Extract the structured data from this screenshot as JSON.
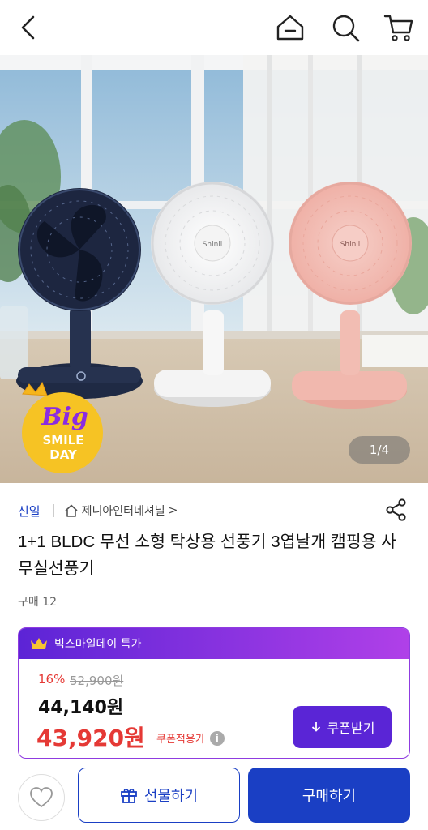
{
  "header": {
    "back_icon": "chevron-left-icon",
    "home_icon": "home-icon",
    "search_icon": "search-icon",
    "cart_icon": "cart-icon"
  },
  "gallery": {
    "page_indicator": "1/4",
    "badge": {
      "line1": "Big",
      "line2": "SMILE",
      "line3": "DAY"
    }
  },
  "seller": {
    "brand": "신일",
    "shop_name": "제니아인터네셔널",
    "shop_chevron": ">"
  },
  "product": {
    "title": "1+1 BLDC 무선 소형 탁상용 선풍기 3엽날개  캠핑용 사무실선풍기",
    "sold": "구매 12"
  },
  "deal": {
    "header": "빅스마일데이 특가",
    "discount": "16%",
    "original_price": "52,900원",
    "price": "44,140원",
    "coupon_price": "43,920원",
    "coupon_label": "쿠폰적용가",
    "coupon_button": "쿠폰받기",
    "accent": "#5a25d6"
  },
  "actions": {
    "gift": "선물하기",
    "buy": "구매하기",
    "primary": "#1a3fc4"
  }
}
